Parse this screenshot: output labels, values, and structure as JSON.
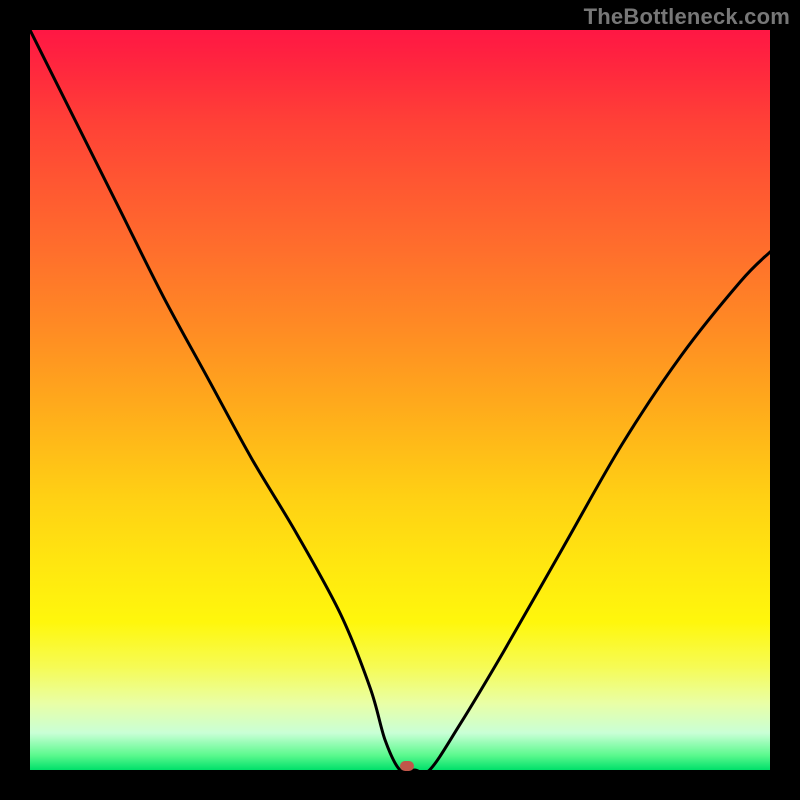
{
  "watermark": "TheBottleneck.com",
  "chart_data": {
    "type": "line",
    "title": "",
    "xlabel": "",
    "ylabel": "",
    "xlim": [
      0,
      100
    ],
    "ylim": [
      0,
      100
    ],
    "grid": false,
    "legend": null,
    "series": [
      {
        "name": "bottleneck-curve",
        "x": [
          0,
          6,
          12,
          18,
          24,
          30,
          36,
          42,
          46,
          48,
          50,
          52,
          54,
          58,
          64,
          72,
          80,
          88,
          96,
          100
        ],
        "y": [
          100,
          88,
          76,
          64,
          53,
          42,
          32,
          21,
          11,
          4,
          0,
          0,
          0,
          6,
          16,
          30,
          44,
          56,
          66,
          70
        ]
      }
    ],
    "annotations": [
      {
        "name": "optimal-point",
        "x": 51,
        "y": 0.6
      }
    ],
    "background": {
      "type": "vertical-gradient",
      "stops": [
        {
          "pct": 0,
          "color": "#ff1744"
        },
        {
          "pct": 50,
          "color": "#ffa81c"
        },
        {
          "pct": 80,
          "color": "#fff70c"
        },
        {
          "pct": 100,
          "color": "#00e06a"
        }
      ]
    }
  }
}
